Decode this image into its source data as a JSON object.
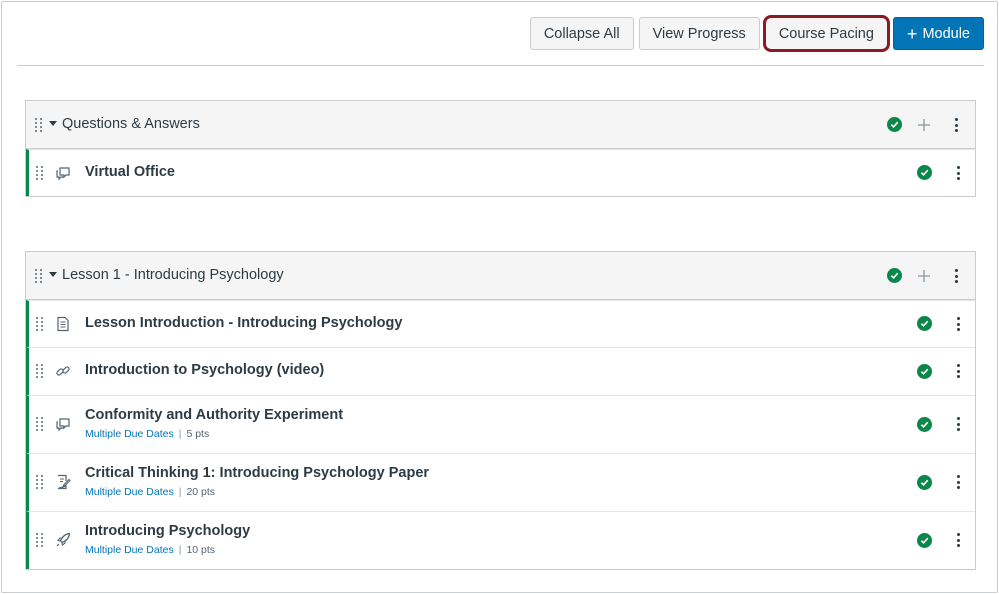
{
  "toolbar": {
    "collapse_all": "Collapse All",
    "view_progress": "View Progress",
    "course_pacing": "Course Pacing",
    "add_module": "Module",
    "add_module_icon": "plus-icon"
  },
  "colors": {
    "accent": "#0374b5",
    "complete": "#0b874b",
    "highlight_outline": "#8b1a23"
  },
  "modules": [
    {
      "title": "Questions & Answers",
      "items": [
        {
          "icon": "discussion-icon",
          "title": "Virtual Office",
          "due": "",
          "points": ""
        }
      ]
    },
    {
      "title": "Lesson 1 - Introducing Psychology",
      "items": [
        {
          "icon": "page-icon",
          "title": "Lesson Introduction - Introducing Psychology",
          "due": "",
          "points": ""
        },
        {
          "icon": "link-icon",
          "title": "Introduction to Psychology (video)",
          "due": "",
          "points": ""
        },
        {
          "icon": "discussion-icon",
          "title": "Conformity and Authority Experiment",
          "due": "Multiple Due Dates",
          "points": "5 pts"
        },
        {
          "icon": "assignment-icon",
          "title": "Critical Thinking 1: Introducing Psychology Paper",
          "due": "Multiple Due Dates",
          "points": "20 pts"
        },
        {
          "icon": "quiz-icon",
          "title": "Introducing Psychology",
          "due": "Multiple Due Dates",
          "points": "10 pts"
        }
      ]
    }
  ]
}
